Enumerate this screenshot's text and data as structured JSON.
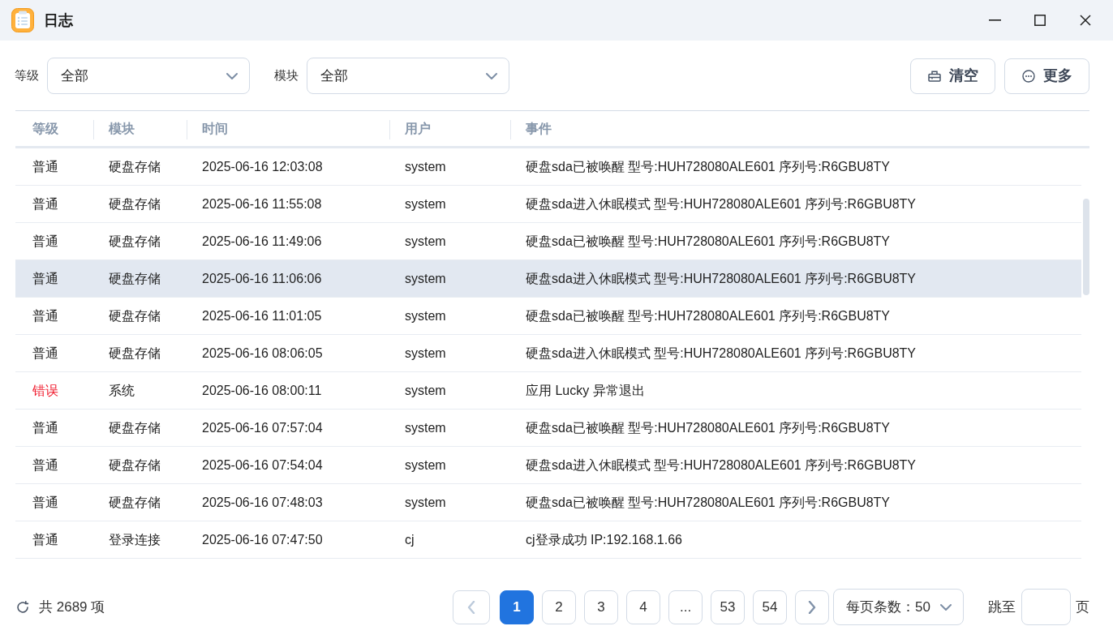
{
  "window": {
    "title": "日志"
  },
  "filters": [
    {
      "label": "等级",
      "value": "全部"
    },
    {
      "label": "模块",
      "value": "全部"
    }
  ],
  "actions": [
    {
      "kind": "clear",
      "label": "清空"
    },
    {
      "kind": "more",
      "label": "更多"
    }
  ],
  "table": {
    "columns": [
      "等级",
      "模块",
      "时间",
      "用户",
      "事件"
    ],
    "rows": [
      {
        "kind": "normal",
        "selected": false,
        "cells": [
          "普通",
          "硬盘存储",
          "2025-06-16 12:03:08",
          "system",
          "硬盘sda已被唤醒 型号:HUH728080ALE601 序列号:R6GBU8TY"
        ]
      },
      {
        "kind": "normal",
        "selected": false,
        "cells": [
          "普通",
          "硬盘存储",
          "2025-06-16 11:55:08",
          "system",
          "硬盘sda进入休眠模式 型号:HUH728080ALE601 序列号:R6GBU8TY"
        ]
      },
      {
        "kind": "normal",
        "selected": false,
        "cells": [
          "普通",
          "硬盘存储",
          "2025-06-16 11:49:06",
          "system",
          "硬盘sda已被唤醒 型号:HUH728080ALE601 序列号:R6GBU8TY"
        ]
      },
      {
        "kind": "normal",
        "selected": true,
        "cells": [
          "普通",
          "硬盘存储",
          "2025-06-16 11:06:06",
          "system",
          "硬盘sda进入休眠模式 型号:HUH728080ALE601 序列号:R6GBU8TY"
        ]
      },
      {
        "kind": "normal",
        "selected": false,
        "cells": [
          "普通",
          "硬盘存储",
          "2025-06-16 11:01:05",
          "system",
          "硬盘sda已被唤醒 型号:HUH728080ALE601 序列号:R6GBU8TY"
        ]
      },
      {
        "kind": "normal",
        "selected": false,
        "cells": [
          "普通",
          "硬盘存储",
          "2025-06-16 08:06:05",
          "system",
          "硬盘sda进入休眠模式 型号:HUH728080ALE601 序列号:R6GBU8TY"
        ]
      },
      {
        "kind": "error",
        "selected": false,
        "cells": [
          "错误",
          "系统",
          "2025-06-16 08:00:11",
          "system",
          "应用 Lucky 异常退出"
        ]
      },
      {
        "kind": "normal",
        "selected": false,
        "cells": [
          "普通",
          "硬盘存储",
          "2025-06-16 07:57:04",
          "system",
          "硬盘sda已被唤醒 型号:HUH728080ALE601 序列号:R6GBU8TY"
        ]
      },
      {
        "kind": "normal",
        "selected": false,
        "cells": [
          "普通",
          "硬盘存储",
          "2025-06-16 07:54:04",
          "system",
          "硬盘sda进入休眠模式 型号:HUH728080ALE601 序列号:R6GBU8TY"
        ]
      },
      {
        "kind": "normal",
        "selected": false,
        "cells": [
          "普通",
          "硬盘存储",
          "2025-06-16 07:48:03",
          "system",
          "硬盘sda已被唤醒 型号:HUH728080ALE601 序列号:R6GBU8TY"
        ]
      },
      {
        "kind": "normal",
        "selected": false,
        "cells": [
          "普通",
          "登录连接",
          "2025-06-16 07:47:50",
          "cj",
          "cj登录成功 IP:192.168.1.66"
        ]
      }
    ]
  },
  "footer": {
    "total": "共 2689 项",
    "pagination": {
      "prev": {
        "disabled": true
      },
      "pages": [
        {
          "label": "1",
          "selected": true
        },
        {
          "label": "2",
          "selected": false
        },
        {
          "label": "3",
          "selected": false
        },
        {
          "label": "4",
          "selected": false
        },
        {
          "label": "...",
          "selected": false
        },
        {
          "label": "53",
          "selected": false
        },
        {
          "label": "54",
          "selected": false
        }
      ],
      "next": {
        "disabled": false
      },
      "page_size": "每页条数：50",
      "jump": {
        "label": "跳至",
        "unit": "页"
      }
    }
  }
}
